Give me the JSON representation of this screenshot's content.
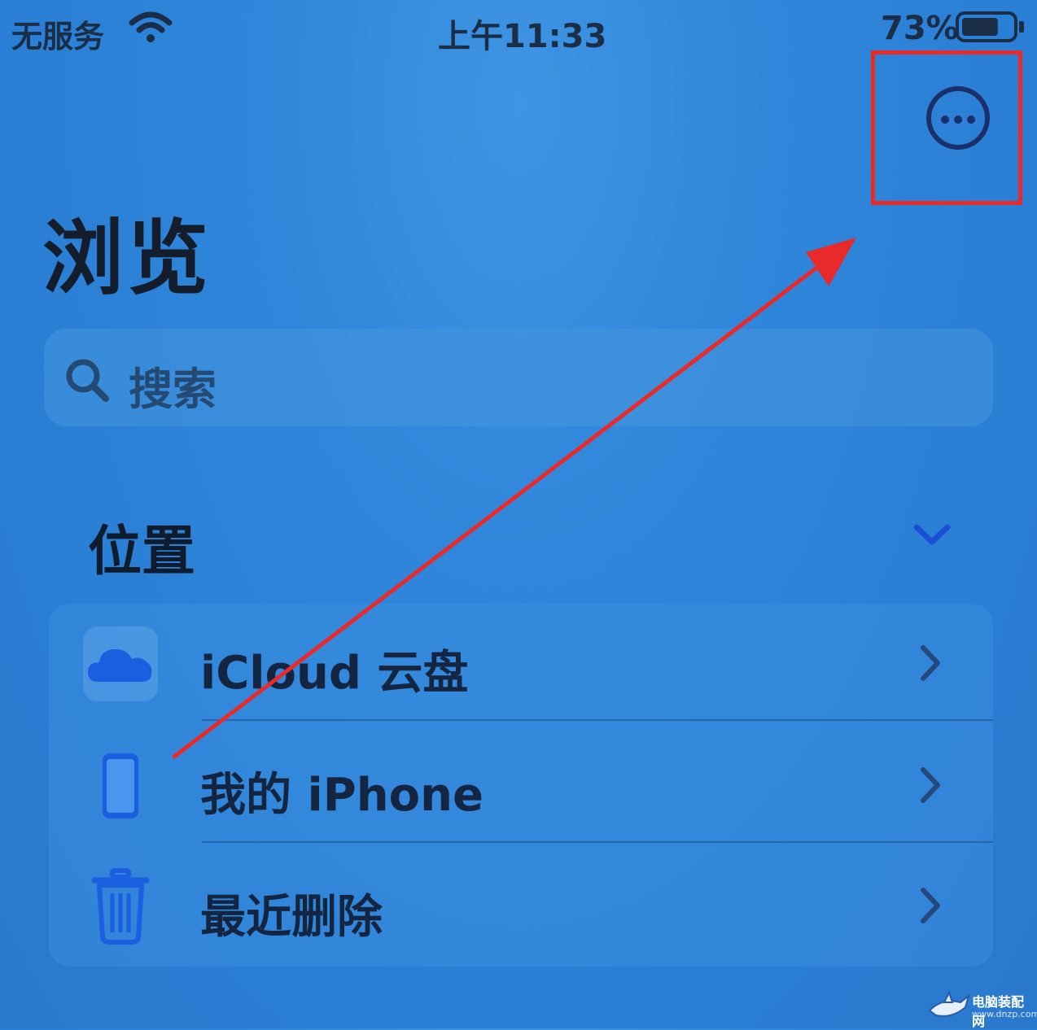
{
  "status_bar": {
    "carrier": "无服务",
    "time": "上午11:33",
    "battery_percent": "73%",
    "battery_level": 0.73
  },
  "toolbar": {
    "more_button_icon": "ellipsis-circle-icon"
  },
  "page": {
    "title": "浏览"
  },
  "search": {
    "placeholder": "搜索"
  },
  "locations": {
    "header": "位置",
    "items": [
      {
        "label": "iCloud 云盘",
        "icon": "icloud-icon"
      },
      {
        "label": "我的 iPhone",
        "icon": "iphone-icon"
      },
      {
        "label": "最近删除",
        "icon": "trash-icon"
      }
    ]
  },
  "annotations": {
    "highlight_color": "#e82a2a"
  },
  "watermark": {
    "title": "电脑装配网",
    "url": "www.dnzp.com"
  },
  "colors": {
    "background": "#2f86da",
    "accent": "#1b4fd6",
    "text_dark": "#131d2c"
  }
}
